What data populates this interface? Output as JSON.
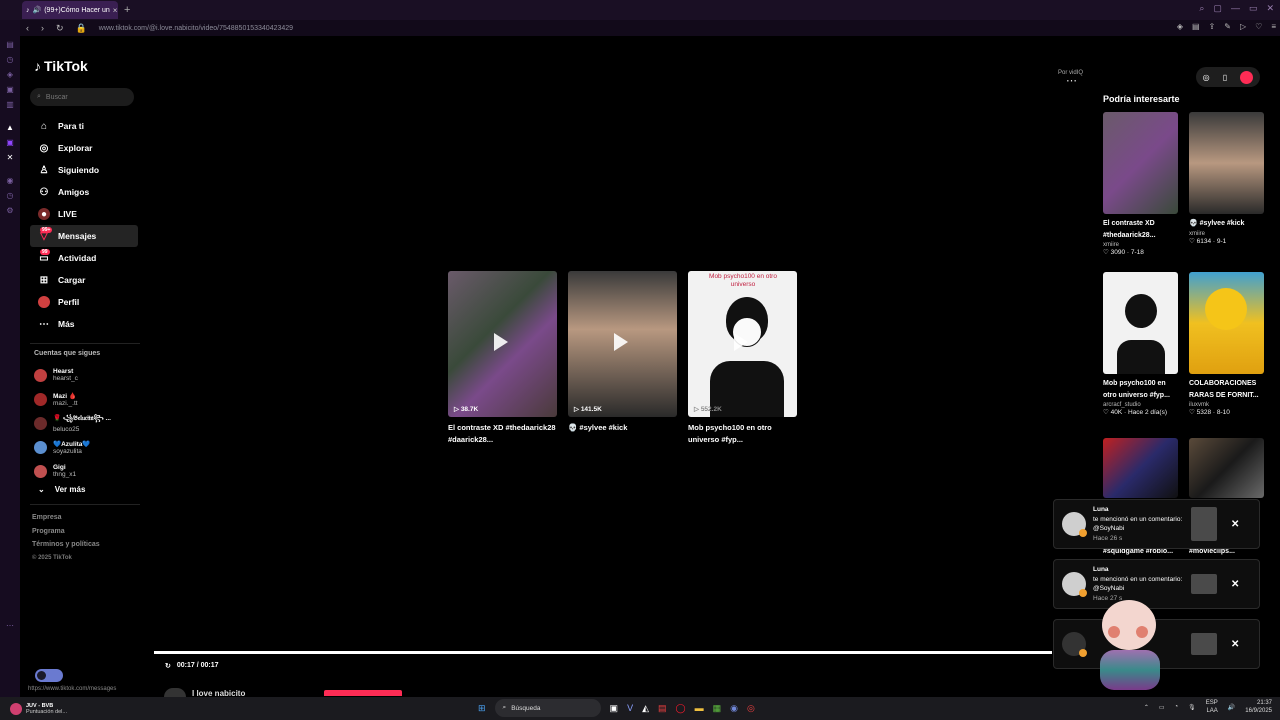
{
  "browser": {
    "tab_title": "(99+)Cómo Hacer un",
    "tab_close": "×",
    "new_tab": "+",
    "url": "www.tiktok.com/@i.love.nabicito/video/7548850153340423429",
    "status_url": "https://www.tiktok.com/messages"
  },
  "sidebar": {
    "logo": "TikTok",
    "search_placeholder": "Buscar",
    "nav": [
      {
        "label": "Para ti",
        "icon": "home-icon"
      },
      {
        "label": "Explorar",
        "icon": "compass-icon"
      },
      {
        "label": "Siguiendo",
        "icon": "following-icon"
      },
      {
        "label": "Amigos",
        "icon": "friends-icon"
      },
      {
        "label": "LIVE",
        "icon": "live-icon"
      },
      {
        "label": "Mensajes",
        "icon": "messages-icon",
        "badge": "99+"
      },
      {
        "label": "Actividad",
        "icon": "activity-icon",
        "badge": "99"
      },
      {
        "label": "Cargar",
        "icon": "upload-icon"
      },
      {
        "label": "Perfil",
        "icon": "profile-icon"
      },
      {
        "label": "Más",
        "icon": "more-icon"
      }
    ],
    "following_title": "Cuentas que sigues",
    "following": [
      {
        "name": "Hearst",
        "handle": "hearst_c",
        "color": "#c04040"
      },
      {
        "name": "Mazi 🩸",
        "handle": "mazi._.tt",
        "color": "#a02828"
      },
      {
        "name": "🌹 ꧁𝔅𝔢𝔩𝔲𝔠𝔦𝔱𝔞꧂ ...",
        "handle": "beluco25",
        "color": "#6b2a2a"
      },
      {
        "name": "💙Azulita💙",
        "handle": "soyazulita",
        "color": "#5b8fd0"
      },
      {
        "name": "Gigi",
        "handle": "thng_x1",
        "color": "#c05050"
      }
    ],
    "see_more": "Ver más",
    "footer": [
      "Empresa",
      "Programa",
      "Términos y políticas"
    ],
    "copyright": "© 2025 TikTok"
  },
  "center": {
    "por_label": "Por vidIQ",
    "cards": [
      {
        "views": "38.7K",
        "caption": "El contraste XD #thedaarick28 #daarick28..."
      },
      {
        "views": "141.5K",
        "caption": "💀 #sylvee #kick"
      },
      {
        "views": "552.2K",
        "caption": "Mob psycho100 en otro universo #fyp...",
        "overlay": "Mob psycho100 en otro universo"
      }
    ]
  },
  "right_panel": {
    "title": "Podría interesarte",
    "cards": [
      {
        "caption": "El contraste XD #thedaarick28...",
        "author": "xmiire",
        "stats": "♡ 3090 · 7-18"
      },
      {
        "caption": "💀 #sylvee #kick",
        "author": "xmiire",
        "stats": "♡ 6134 · 9-1"
      },
      {
        "caption": "Mob psycho100 en otro universo #fyp...",
        "author": "arcracf_studio",
        "stats": "♡ 40K · Hace 2 día(s)"
      },
      {
        "caption": "COLABORACIONES RARAS DE FORNIT...",
        "author": "iluxvmk",
        "stats": "♡ 5328 · 8-10"
      }
    ],
    "under_captions": [
      "#squidgame #roblo...",
      "#movieclips..."
    ]
  },
  "notifications": [
    {
      "user": "Luna",
      "text": "te mencionó en un comentario: @SoyNabi",
      "time": "Hace 26 s"
    },
    {
      "user": "Luna",
      "text": "te mencionó en un comentario: @SoyNabi",
      "time": "Hace 27 s"
    },
    {
      "user": "",
      "text": "",
      "time": ""
    }
  ],
  "player": {
    "time": "00:17 / 00:17",
    "author": "I love nabicito",
    "progress": 1.0
  },
  "taskbar": {
    "weather_title": "JUV - BVB",
    "weather_sub": "Puntuación del...",
    "search": "Búsqueda",
    "lang_top": "ESP",
    "lang_bottom": "LAA",
    "time": "21:37",
    "date": "16/9/2025"
  }
}
